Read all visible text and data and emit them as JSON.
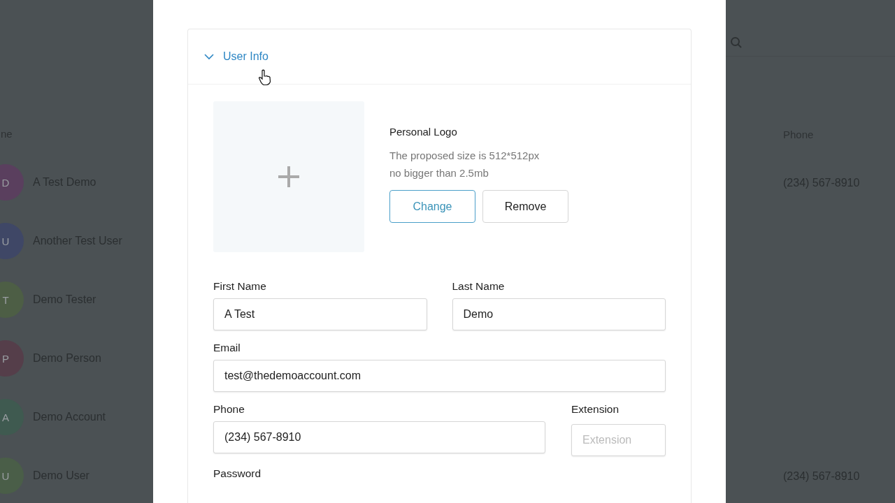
{
  "background_table": {
    "columns": [
      "ne",
      "Phone"
    ],
    "rows": [
      {
        "initial": "D",
        "name": "A Test Demo",
        "phone": "(234) 567-8910",
        "color": "#5a3f5e"
      },
      {
        "initial": "U",
        "name": "Another Test User",
        "color": "#3f4766"
      },
      {
        "initial": "T",
        "name": "Demo Tester",
        "color": "#4d5e45"
      },
      {
        "initial": "P",
        "name": "Demo Person",
        "color": "#553e4a"
      },
      {
        "initial": "A",
        "name": "Demo Account",
        "color": "#3f5a50"
      },
      {
        "initial": "U",
        "name": "Demo User",
        "phone": "(234) 567-8910",
        "color": "#4a5e48"
      }
    ]
  },
  "modal": {
    "section": {
      "title": "User Info",
      "expanded": true
    },
    "logo": {
      "label": "Personal Logo",
      "hint_lines": [
        "The proposed size is 512*512px",
        "no bigger than 2.5mb"
      ],
      "buttons": [
        {
          "label": "Change",
          "kind": "primary"
        },
        {
          "label": "Remove",
          "kind": "secondary"
        }
      ]
    },
    "field_rows": [
      [
        {
          "label": "First Name",
          "value": "A Test",
          "kind": "half"
        },
        {
          "label": "Last Name",
          "value": "Demo",
          "kind": "half"
        }
      ],
      [
        {
          "label": "Email",
          "value": "test@thedemoaccount.com",
          "kind": "full"
        }
      ],
      [
        {
          "label": "Phone",
          "value": "(234) 567-8910",
          "kind": "main"
        },
        {
          "label": "Extension",
          "placeholder": "Extension",
          "kind": "short"
        }
      ],
      [
        {
          "label": "Password",
          "kind": "label"
        }
      ]
    ]
  }
}
